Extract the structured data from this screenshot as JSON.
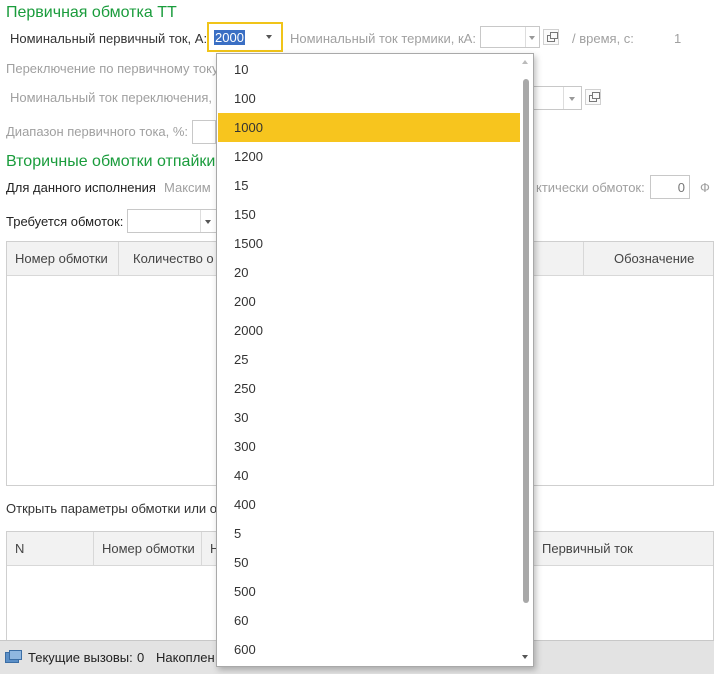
{
  "section_primary": {
    "title": "Первичная обмотка ТТ",
    "nominal_primary_label": "Номинальный первичный ток, А:",
    "nominal_primary_value": "2000",
    "thermal_label": "Номинальный ток термики, кА:",
    "time_label": "/ время, с:",
    "time_value": "1",
    "switching_label": "Переключение по первичному току",
    "switch_nominal_label": "Номинальный ток переключения,",
    "range_label": "Диапазон первичного тока, %:"
  },
  "section_secondary": {
    "title": "Вторичные обмотки отпайки",
    "for_execution_label": "Для данного исполнения",
    "max_label": "Максим",
    "actual_label": "ктически обмоток:",
    "actual_value": "0",
    "actual_suffix": "Ф",
    "required_label": "Требуется обмоток:"
  },
  "table1": {
    "columns": [
      "Номер обмотки",
      "Количество о",
      "Обозначение"
    ]
  },
  "open_params_text": "Открыть параметры обмотки или от",
  "table2": {
    "columns": [
      "N",
      "Номер обмотки",
      "Н",
      "Первичный ток"
    ]
  },
  "statusbar": {
    "calls_label": "Текущие вызовы:",
    "calls_value": "0",
    "accum_label": "Накоплен"
  },
  "dropdown": {
    "selected": "1000",
    "options": [
      "10",
      "100",
      "1000",
      "1200",
      "15",
      "150",
      "1500",
      "20",
      "200",
      "2000",
      "25",
      "250",
      "30",
      "300",
      "40",
      "400",
      "5",
      "50",
      "500",
      "60",
      "600"
    ]
  },
  "colors": {
    "section_title": "#1a9c3c",
    "highlight": "#f7c51e",
    "focus_border": "#f0c419"
  }
}
